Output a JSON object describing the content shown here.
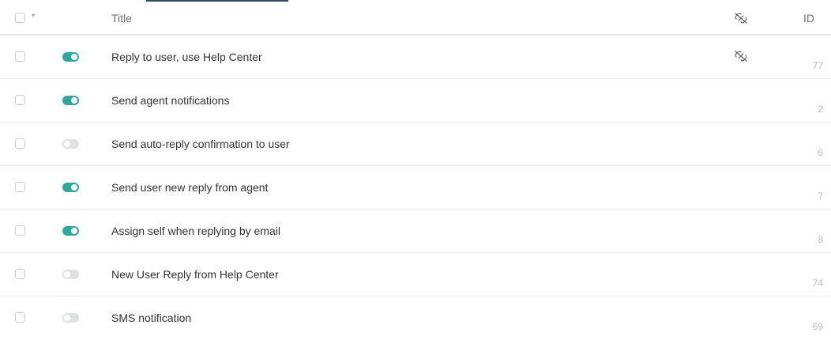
{
  "header": {
    "title_label": "Title",
    "id_label": "ID",
    "sort_caret": "▾",
    "link_icon": "unlink-icon"
  },
  "colors": {
    "toggle_on": "#2aa9a1",
    "toggle_off": "#dfe2e5",
    "accent": "#2f4a68"
  },
  "rows": [
    {
      "title": "Reply to user, use Help Center",
      "enabled": true,
      "linked_icon": true,
      "id": "77"
    },
    {
      "title": "Send agent notifications",
      "enabled": true,
      "linked_icon": false,
      "id": "2"
    },
    {
      "title": "Send auto-reply confirmation to user",
      "enabled": false,
      "linked_icon": false,
      "id": "6"
    },
    {
      "title": "Send user new reply from agent",
      "enabled": true,
      "linked_icon": false,
      "id": "7"
    },
    {
      "title": "Assign self when replying by email",
      "enabled": true,
      "linked_icon": false,
      "id": "8"
    },
    {
      "title": "New User Reply from Help Center",
      "enabled": false,
      "linked_icon": false,
      "id": "74"
    },
    {
      "title": "SMS notification",
      "enabled": false,
      "linked_icon": false,
      "id": "69"
    }
  ]
}
